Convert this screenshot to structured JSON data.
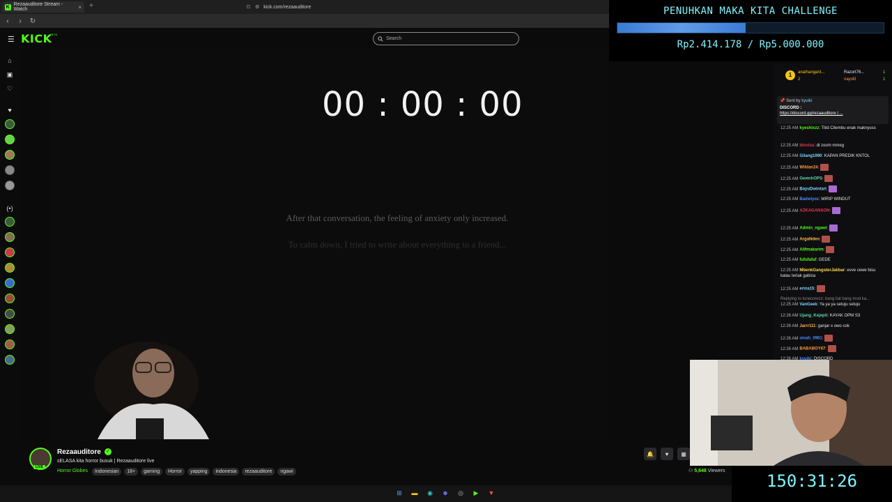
{
  "browser": {
    "tab_title": "Rezaauditore Stream - Watch",
    "tab_close": "×",
    "new_tab": "+",
    "url": "kick.com/rezaauditore"
  },
  "kick": {
    "logo": "KICK",
    "beta": "BETA",
    "search_placeholder": "Search"
  },
  "video": {
    "timer": "00 : 00 : 00",
    "subtitle_1": "After that conversation, the feeling of anxiety only increased.",
    "subtitle_2": "To calm down, I tried to write about everything to a friend..."
  },
  "stream": {
    "channel_name": "Rezaauditore",
    "live_badge": "LIVE",
    "title": "sELASA kita horror busuk | Rezaauditore live",
    "category": "Horror Globes",
    "tags": [
      "Indonesian",
      "18+",
      "gaming",
      "Horror",
      "yapping",
      "indonesia",
      "rezaauditore",
      "ngawi"
    ],
    "viewers_count": "5,648",
    "viewers_label": "Viewers"
  },
  "goal": {
    "title": "PENUHKAN MAKA KITA CHALLENGE",
    "amount": "Rp2.414.178 / Rp5.000.000",
    "progress": 0.4828
  },
  "chat": {
    "gifters": [
      {
        "rank": "1",
        "name": "anathangant...",
        "count": "2"
      },
      {
        "name": "Razort76...",
        "count": "1"
      },
      {
        "name": "nayolll",
        "count": "1"
      }
    ],
    "pinned": {
      "sent_by": "Sent by",
      "user": "kyuiki",
      "label": "DISCORD :",
      "link": "https://discord.gg/rezaauditore | ..."
    },
    "messages": [
      {
        "time": "12:25 AM",
        "user": "kyeshixzz",
        "color": "#53fc18",
        "text": "Titid Cilembu enak maknyuss"
      },
      {
        "time": "12:25 AM",
        "user": "blnolss",
        "color": "#e53950",
        "text": "di zoom mmeg"
      },
      {
        "time": "12:25 AM",
        "user": "Gilang1990",
        "color": "#7fd4ff",
        "text": "KAPAN PREDIK KNTOL"
      },
      {
        "time": "12:25 AM",
        "user": "Wildan24",
        "color": "#ff9a3c",
        "text": ""
      },
      {
        "time": "12:25 AM",
        "user": "GwenhOPS",
        "color": "#5fd4a8",
        "text": ""
      },
      {
        "time": "12:25 AM",
        "user": "BayuDwintari",
        "color": "#7fd4ff",
        "text": ""
      },
      {
        "time": "12:25 AM",
        "user": "Badwiyoz",
        "color": "#4a8cff",
        "text": "MIRIP WINDUT"
      },
      {
        "time": "12:25 AM",
        "user": "AZKAGANSON",
        "color": "#e53950",
        "text": ""
      },
      {
        "time": "12:25 AM",
        "user": "Admin_ngawi",
        "color": "#53fc18",
        "text": ""
      },
      {
        "time": "12:25 AM",
        "user": "ArgaNden",
        "color": "#ffb84d",
        "text": ""
      },
      {
        "time": "12:25 AM",
        "user": "Alifmakarim",
        "color": "#53fc18",
        "text": ""
      },
      {
        "time": "12:25 AM",
        "user": "fufufafaf",
        "color": "#53fc18",
        "text": "GEDE"
      },
      {
        "time": "12:25 AM",
        "user": "MbenkGangsterJakbar",
        "color": "#ffd84d",
        "text": "evve cewe bisu kalau teriak gabisa"
      },
      {
        "time": "12:25 AM",
        "user": "erina15",
        "color": "#7fd4ff",
        "text": ""
      },
      {
        "time": "",
        "user": "",
        "color": "#888",
        "text": "Replying to lunecorezz: bang liat bang mod ka..."
      },
      {
        "time": "12:25 AM",
        "user": "VanGeek",
        "color": "#7fd4ff",
        "text": "Ya ya ya setuju setuju"
      },
      {
        "time": "12:26 AM",
        "user": "Ujang_Kejepit",
        "color": "#5fd4a8",
        "text": "KAYAK OPM S3"
      },
      {
        "time": "12:26 AM",
        "user": "Jarrr111",
        "color": "#ffb84d",
        "text": "ganjar x owo cok"
      },
      {
        "time": "12:26 AM",
        "user": "oivah_0961",
        "color": "#4a8cff",
        "text": ""
      },
      {
        "time": "12:26 AM",
        "user": "BABABOY67",
        "color": "#ff9a3c",
        "text": ""
      },
      {
        "time": "12:26 AM",
        "user": "kyuiki",
        "color": "#4a8cff",
        "text": "DISCORD"
      }
    ]
  },
  "countdown": "150:31:26",
  "colors": {
    "accent": "#53fc18",
    "overlay_text": "#7ff5ff"
  }
}
